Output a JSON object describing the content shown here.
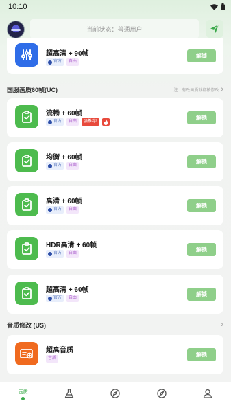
{
  "statusbar": {
    "time": "10:10"
  },
  "topbar": {
    "status_text": "当前状态：普通用户"
  },
  "colors": {
    "accent_green": "#4dbb4e",
    "unlock_button": "#8fcf8a",
    "recommend_red": "#e84a3c"
  },
  "cards_top": [
    {
      "title": "超高清 + 90帧",
      "tag_official": "官方",
      "tag_free": "自由"
    }
  ],
  "section_uc": {
    "title": "国服画质60帧(UC)",
    "note": "注：有改画质就都被修改"
  },
  "cards_uc": [
    {
      "title": "流畅 + 60帧",
      "tag_official": "官方",
      "tag_free": "自由",
      "tag_recommend": "强推荐!"
    },
    {
      "title": "均衡 + 60帧",
      "tag_official": "官方",
      "tag_free": "自由"
    },
    {
      "title": "高清 + 60帧",
      "tag_official": "官方",
      "tag_free": "自由"
    },
    {
      "title": "HDR高清 + 60帧",
      "tag_official": "官方",
      "tag_free": "自由"
    },
    {
      "title": "超高清 + 60帧",
      "tag_official": "官方",
      "tag_free": "自由"
    }
  ],
  "section_us": {
    "title": "音质修改 (US)"
  },
  "cards_us": [
    {
      "title": "超高音质",
      "tag_official": "音质"
    }
  ],
  "unlock_label": "解锁",
  "bottomnav": {
    "home_label": "画质"
  }
}
